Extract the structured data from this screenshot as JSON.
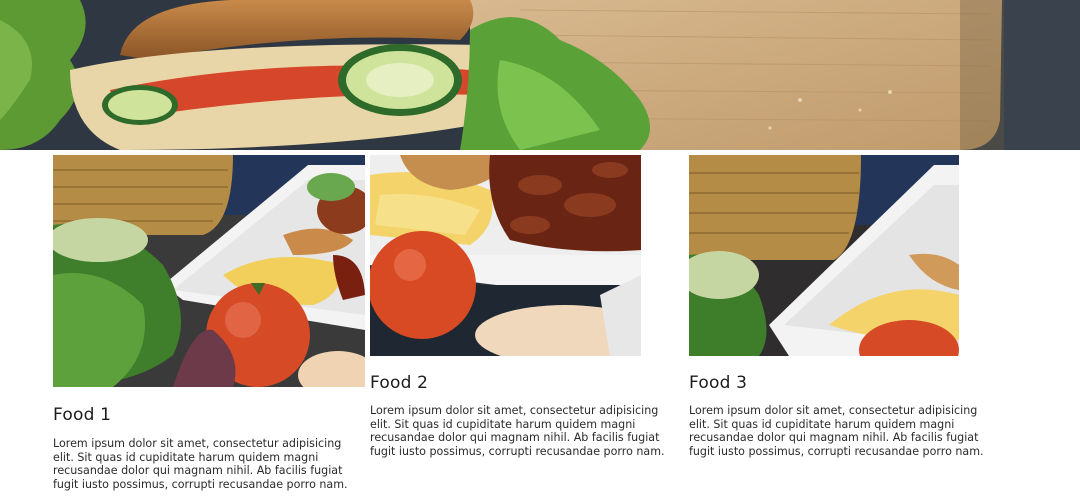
{
  "hero": {
    "image": "food-hero-photo"
  },
  "cards": [
    {
      "image": "food-photo-1",
      "title": "Food 1",
      "text": "Lorem ipsum dolor sit amet, consectetur adipisicing elit. Sit quas id cupiditate harum quidem magni recusandae dolor qui magnam nihil. Ab facilis fugiat fugit iusto possimus, corrupti recusandae porro nam."
    },
    {
      "image": "food-photo-2",
      "title": "Food 2",
      "text": "Lorem ipsum dolor sit amet, consectetur adipisicing elit. Sit quas id cupiditate harum quidem magni recusandae dolor qui magnam nihil. Ab facilis fugiat fugit iusto possimus, corrupti recusandae porro nam."
    },
    {
      "image": "food-photo-3",
      "title": "Food 3",
      "text": "Lorem ipsum dolor sit amet, consectetur adipisicing elit. Sit quas id cupiditate harum quidem magni recusandae dolor qui magnam nihil. Ab facilis fugiat fugit iusto possimus, corrupti recusandae porro nam."
    }
  ],
  "colors": {
    "background": "#ffffff",
    "text": "#1b1b1b",
    "cutting_board": "#c9a77c",
    "lettuce": "#4f8a2c",
    "tomato": "#d64a26",
    "basket": "#b58c45",
    "plate": "#f2f2f2",
    "mango": "#f3d36a",
    "tablecloth": "#233558"
  }
}
